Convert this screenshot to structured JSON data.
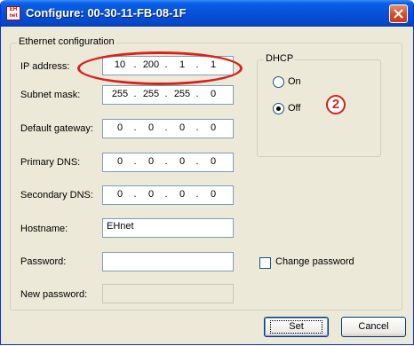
{
  "window": {
    "title": "Configure: 00-30-11-FB-08-1F",
    "app_icon_text": "EH net",
    "close_icon": "close-icon"
  },
  "ethernet": {
    "legend": "Ethernet configuration",
    "ip_label": "IP address:",
    "ip": [
      "10",
      "200",
      "1",
      "1"
    ],
    "subnet_label": "Subnet mask:",
    "subnet": [
      "255",
      "255",
      "255",
      "0"
    ],
    "gateway_label": "Default gateway:",
    "gateway": [
      "0",
      "0",
      "0",
      "0"
    ],
    "primary_dns_label": "Primary DNS:",
    "primary_dns": [
      "0",
      "0",
      "0",
      "0"
    ],
    "secondary_dns_label": "Secondary DNS:",
    "secondary_dns": [
      "0",
      "0",
      "0",
      "0"
    ],
    "hostname_label": "Hostname:",
    "hostname": "EHnet",
    "password_label": "Password:",
    "password": "",
    "new_password_label": "New password:",
    "new_password": "",
    "dot": "."
  },
  "dhcp": {
    "legend": "DHCP",
    "on_label": "On",
    "off_label": "Off",
    "selected": "Off"
  },
  "change_password": {
    "label": "Change password",
    "checked": false
  },
  "annotation": {
    "badge": "2",
    "color": "#d8231b"
  },
  "buttons": {
    "set": "Set",
    "cancel": "Cancel"
  }
}
